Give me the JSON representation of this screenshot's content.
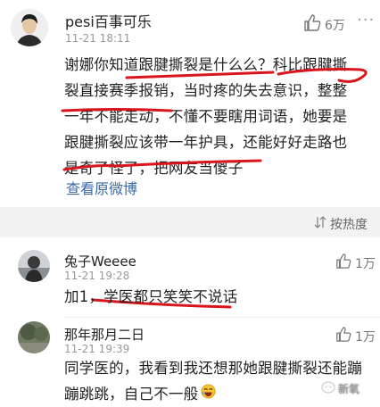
{
  "main_comment": {
    "username": "pesi百事可乐",
    "timestamp": "11-21 18:11",
    "like_count": "6万",
    "lines": [
      "谢娜你知道跟腱撕裂是什么么？科比跟腱撕",
      "裂直接赛季报销，当时疼的失去意识，整整",
      "一年不能走动，不懂不要瞎用词语，她要是",
      "跟腱撕裂应该带一年护具，还能好好走路也",
      "是奇了怪了，把网友当傻子"
    ],
    "view_original": "查看原微博"
  },
  "sort": {
    "label": "按热度"
  },
  "replies": [
    {
      "username": "兔子Weeee",
      "timestamp": "11-21 19:28",
      "like_count": "1万",
      "text": "加1，学医都只笑笑不说话"
    },
    {
      "username": "那年那月二日",
      "timestamp": "11-21 19:39",
      "like_count": "1万",
      "lines": [
        "同学医的，我看到我还想那她跟腱撕裂还能蹦",
        "蹦跳跳，自己不一般"
      ]
    }
  ],
  "watermark": {
    "text": "新氧"
  },
  "colors": {
    "annotation": "#d9141b",
    "link": "#3b6aa8"
  },
  "icons": [
    "thumbs-up-icon",
    "more-icon",
    "sort-icon",
    "laughing-emoji-icon"
  ]
}
